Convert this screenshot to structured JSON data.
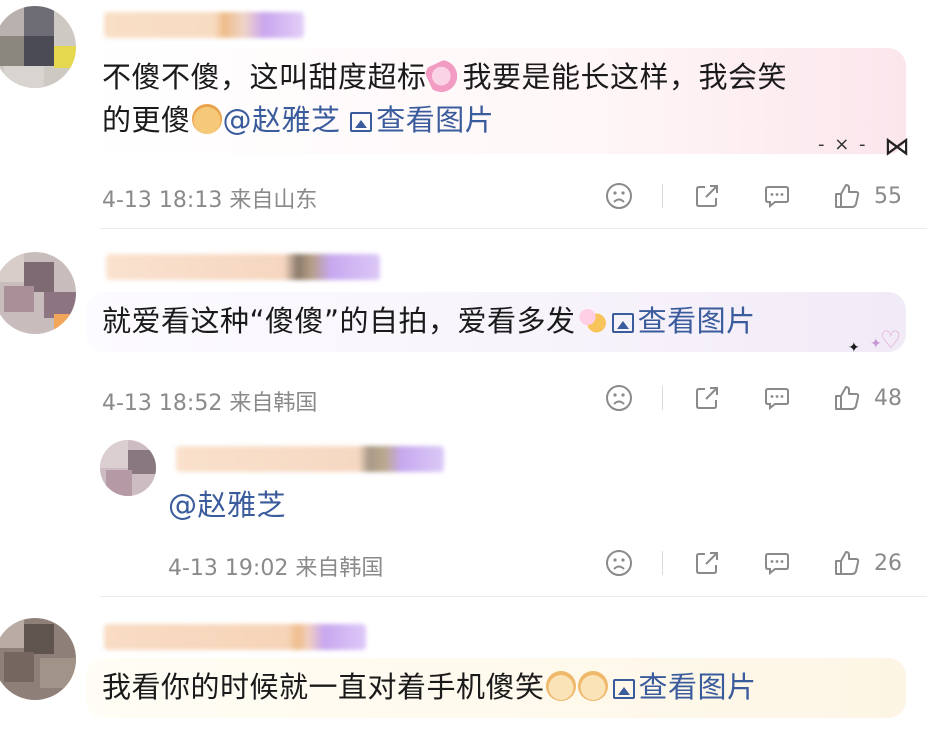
{
  "comments": [
    {
      "text": "不傻不傻，这叫甜度超标",
      "text2": "我要是能长这样，我会笑",
      "text3": "的更傻",
      "mention": "@赵雅芝",
      "view_pic": "查看图片",
      "time_loc": "4-13 18:13  来自山东",
      "likes": "55"
    },
    {
      "text": "就爱看这种“傻傻”的自拍，爱看多发",
      "view_pic": "查看图片",
      "time_loc": "4-13 18:52  来自韩国",
      "likes": "48"
    },
    {
      "mention": "@赵雅芝",
      "time_loc": "4-13 19:02  来自韩国",
      "likes": "26"
    },
    {
      "text": "我看你的时候就一直对着手机傻笑",
      "view_pic": "查看图片"
    }
  ],
  "icons": {
    "dislike": "sad-face-icon",
    "share": "share-icon",
    "comment": "comment-icon",
    "like": "thumbs-up-icon",
    "image": "image-icon"
  },
  "colors": {
    "link": "#3a5b9c",
    "meta": "#8a8a8a"
  }
}
